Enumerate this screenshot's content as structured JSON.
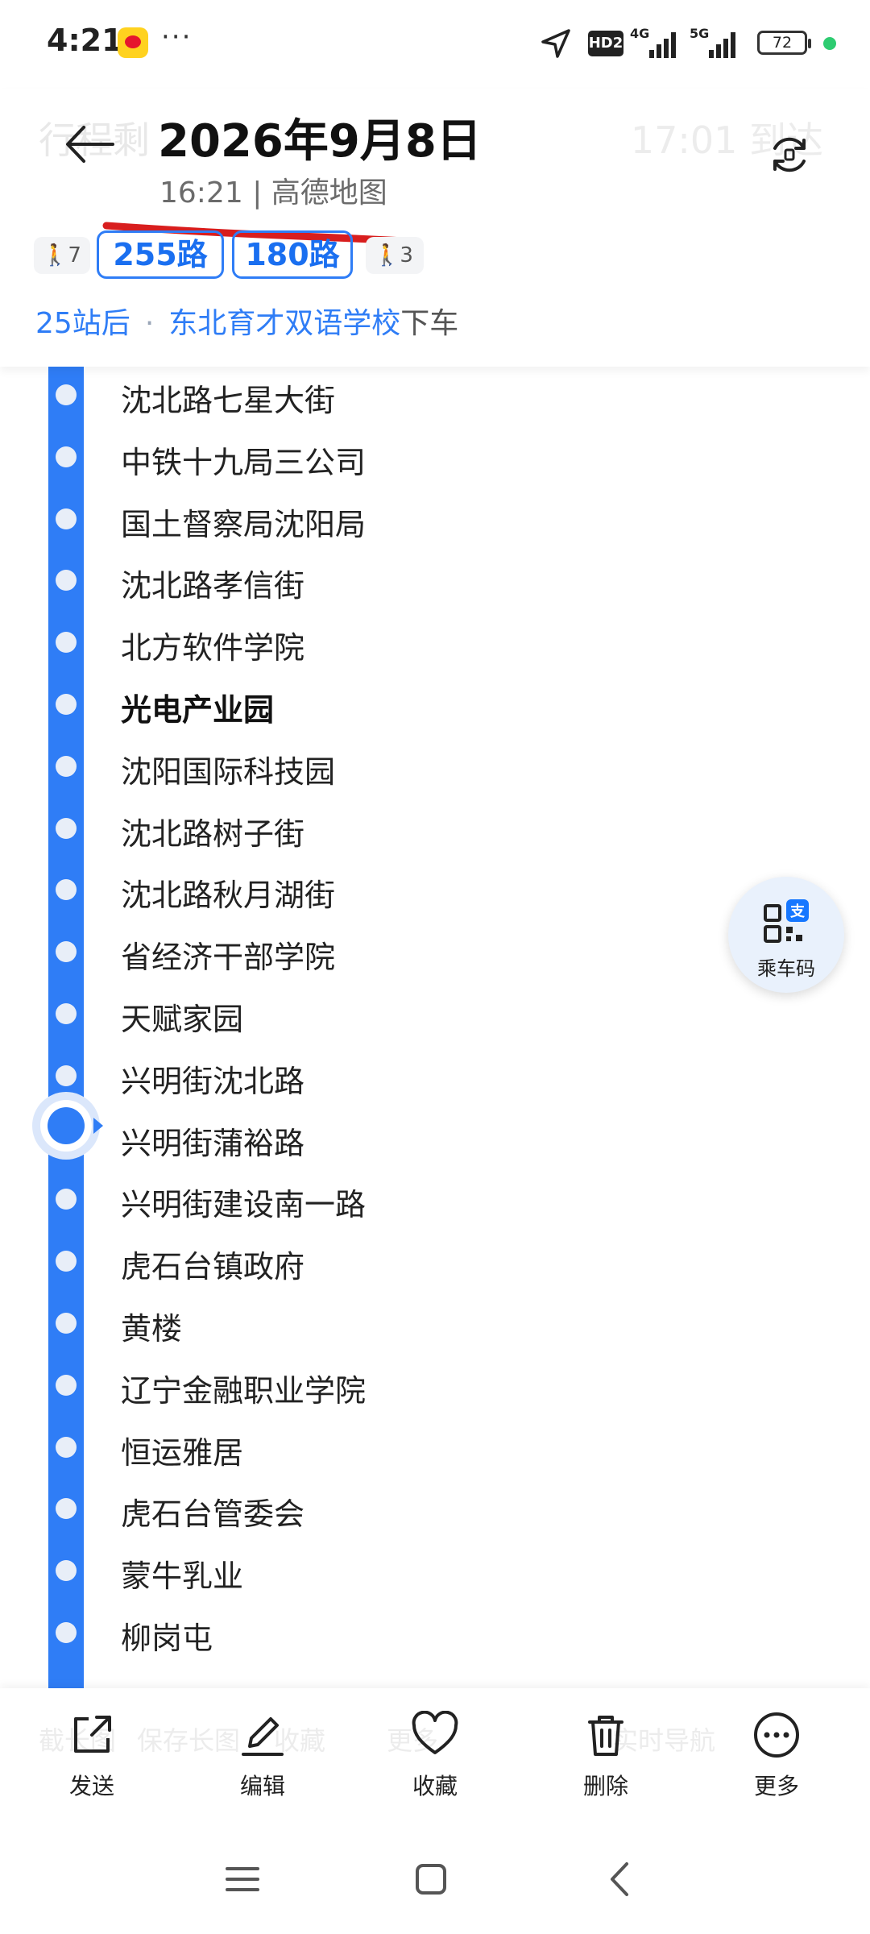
{
  "status_bar": {
    "time": "4:21",
    "dots": "···",
    "hd_label": "HD2",
    "net_4g": "4G",
    "net_5g": "5G",
    "battery": "72"
  },
  "header": {
    "ghost_left": "行程剩",
    "ghost_right": "17:01 到达",
    "title": "2026年9月8日",
    "subtitle": "16:21 | 高德地图",
    "route": {
      "walk_start": "7",
      "bus_lines": [
        "255路",
        "180路"
      ],
      "walk_end": "3"
    },
    "alight": {
      "stops": "25站后",
      "separator": "·",
      "station": "东北育才双语学校",
      "action": "下车"
    }
  },
  "stations": [
    "沈北路七星大街",
    "中铁十九局三公司",
    "国土督察局沈阳局",
    "沈北路孝信街",
    "北方软件学院",
    "光电产业园",
    "沈阳国际科技园",
    "沈北路树子街",
    "沈北路秋月湖街",
    "省经济干部学院",
    "天赋家园",
    "兴明街沈北路",
    "兴明街蒲裕路",
    "兴明街建设南一路",
    "虎石台镇政府",
    "黄楼",
    "辽宁金融职业学院",
    "恒运雅居",
    "虎石台管委会",
    "蒙牛乳业",
    "柳岗屯"
  ],
  "current_station_index": 5,
  "ride_code_label": "乘车码",
  "actions": {
    "send": "发送",
    "edit": "编辑",
    "favorite": "收藏",
    "delete": "删除",
    "more": "更多"
  },
  "ghost_actions": {
    "a1": "截长图",
    "a2": "保存长图",
    "a3": "收藏",
    "a4": "更多",
    "a5": "实时导航"
  },
  "colors": {
    "route_blue": "#2f7df6",
    "underline_red": "#d81e1e",
    "status_green": "#2ecc71"
  }
}
